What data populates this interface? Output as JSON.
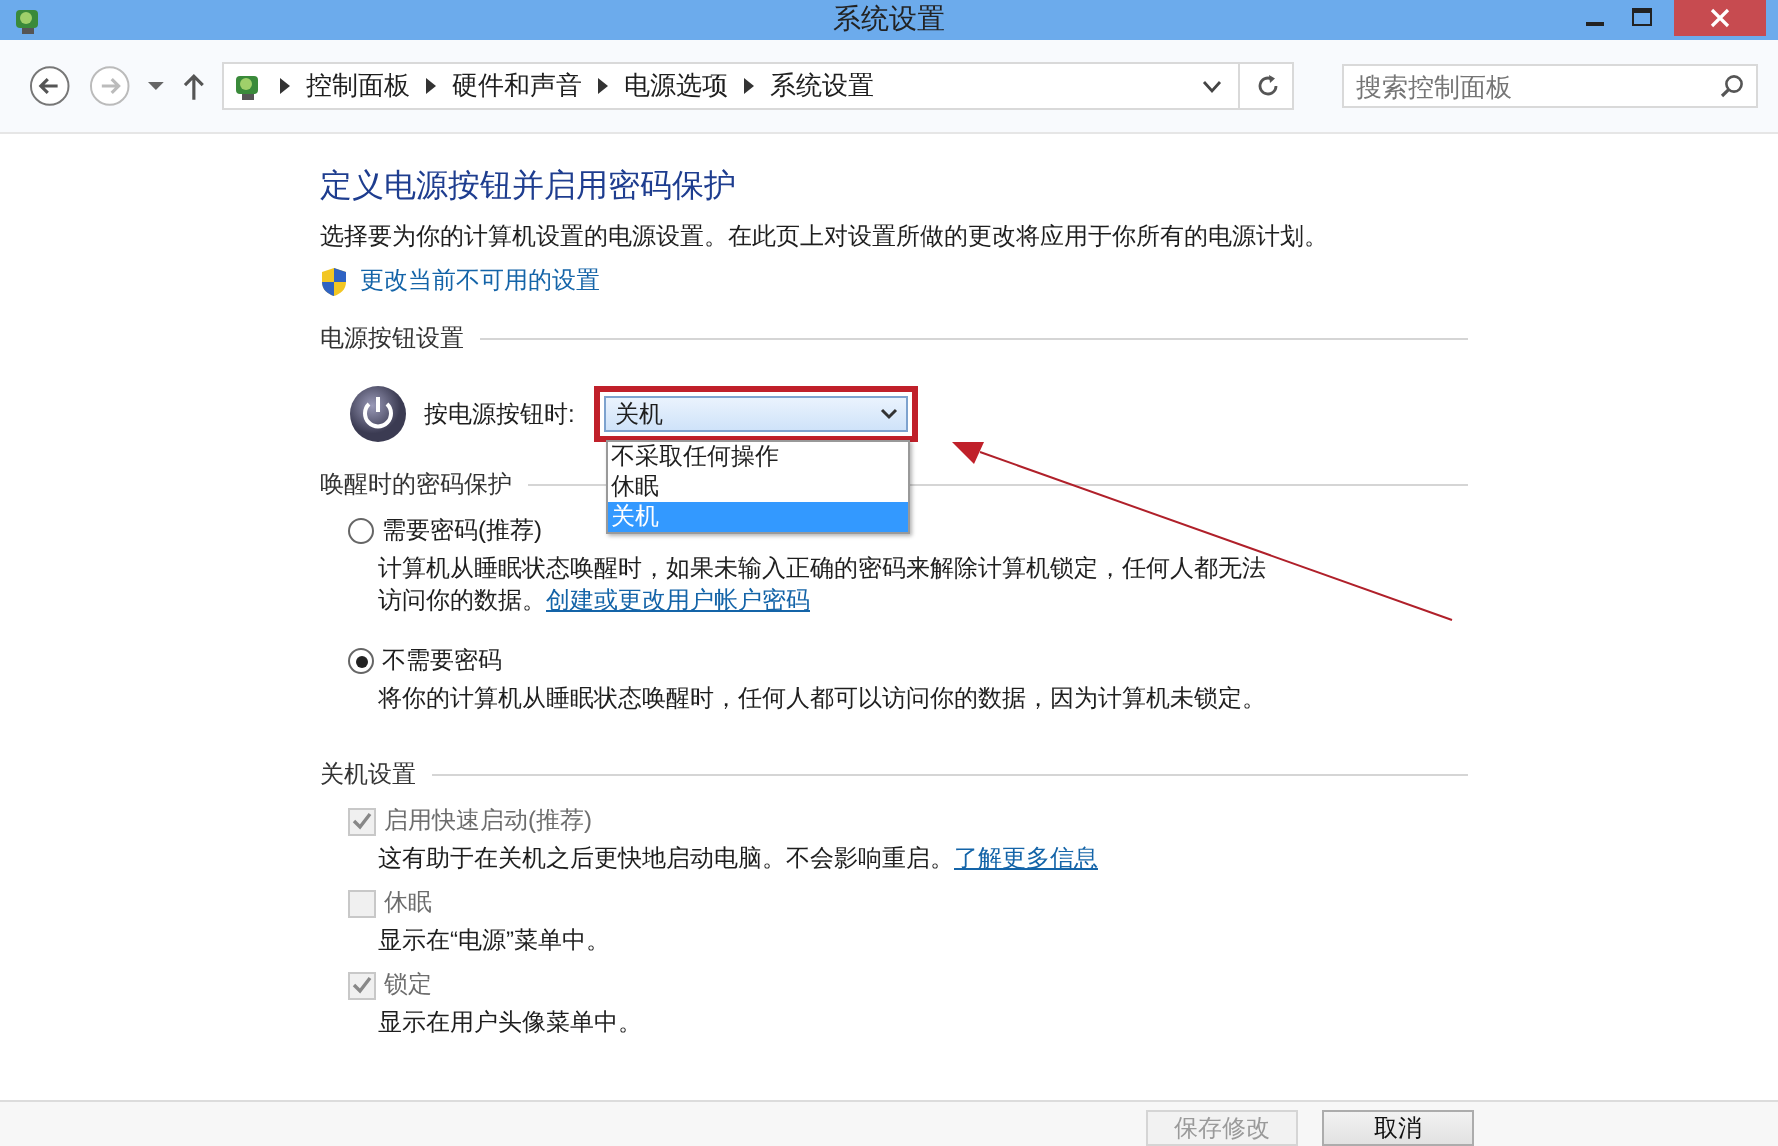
{
  "window": {
    "title": "系统设置"
  },
  "nav": {
    "breadcrumb": [
      "控制面板",
      "硬件和声音",
      "电源选项",
      "系统设置"
    ],
    "search": {
      "placeholder": "搜索控制面板"
    }
  },
  "heading": "定义电源按钮并启用密码保护",
  "description": "选择要为你的计算机设置的电源设置。在此页上对设置所做的更改将应用于你所有的电源计划。",
  "admin_link": "更改当前不可用的设置",
  "power_section": {
    "title": "电源按钮设置",
    "label": "按电源按钮时:",
    "dropdown": {
      "value": "关机",
      "expanded": true,
      "highlighted": true,
      "options": [
        {
          "label": "不采取任何操作",
          "selected": false
        },
        {
          "label": "休眠",
          "selected": false
        },
        {
          "label": "关机",
          "selected": true
        }
      ]
    }
  },
  "password_section": {
    "title": "唤醒时的密码保护",
    "options": [
      {
        "label": "需要密码(推荐)",
        "selected": false,
        "description": "计算机从睡眠状态唤醒时，如果未输入正确的密码来解除计算机锁定，任何人都无法访问你的数据。",
        "link": "创建或更改用户帐户密码"
      },
      {
        "label": "不需要密码",
        "selected": true,
        "description": "将你的计算机从睡眠状态唤醒时，任何人都可以访问你的数据，因为计算机未锁定。"
      }
    ]
  },
  "shutdown_section": {
    "title": "关机设置",
    "options": [
      {
        "label": "启用快速启动(推荐)",
        "checked": true,
        "disabled": true,
        "description": "这有助于在关机之后更快地启动电脑。不会影响重启。",
        "link": "了解更多信息"
      },
      {
        "label": "休眠",
        "checked": false,
        "disabled": true,
        "description": "显示在“电源”菜单中。"
      },
      {
        "label": "锁定",
        "checked": true,
        "disabled": true,
        "description": "显示在用户头像菜单中。"
      }
    ]
  },
  "buttons": [
    {
      "label": "保存修改",
      "disabled": true
    },
    {
      "label": "取消",
      "disabled": false
    }
  ]
}
